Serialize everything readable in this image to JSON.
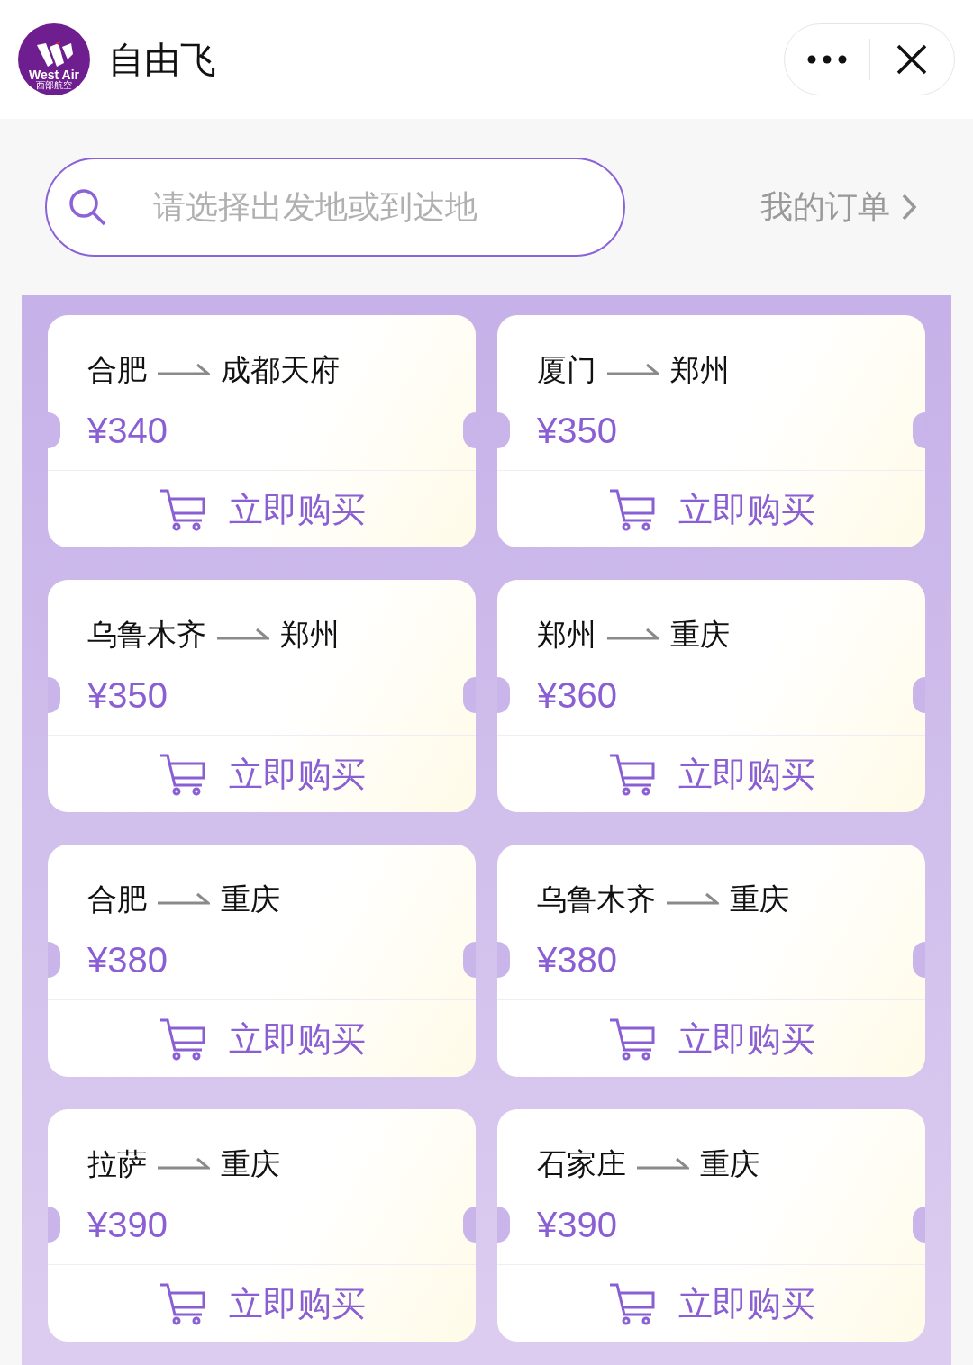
{
  "header": {
    "logo_text": "West Air",
    "logo_subtext": "西部航空",
    "title": "自由飞"
  },
  "search": {
    "placeholder": "请选择出发地或到达地"
  },
  "orders_link": "我的订单",
  "routes": [
    {
      "from": "合肥",
      "to": "成都天府",
      "price": "¥340",
      "action": "立即购买"
    },
    {
      "from": "厦门",
      "to": "郑州",
      "price": "¥350",
      "action": "立即购买"
    },
    {
      "from": "乌鲁木齐",
      "to": "郑州",
      "price": "¥350",
      "action": "立即购买"
    },
    {
      "from": "郑州",
      "to": "重庆",
      "price": "¥360",
      "action": "立即购买"
    },
    {
      "from": "合肥",
      "to": "重庆",
      "price": "¥380",
      "action": "立即购买"
    },
    {
      "from": "乌鲁木齐",
      "to": "重庆",
      "price": "¥380",
      "action": "立即购买"
    },
    {
      "from": "拉萨",
      "to": "重庆",
      "price": "¥390",
      "action": "立即购买"
    },
    {
      "from": "石家庄",
      "to": "重庆",
      "price": "¥390",
      "action": "立即购买"
    }
  ]
}
